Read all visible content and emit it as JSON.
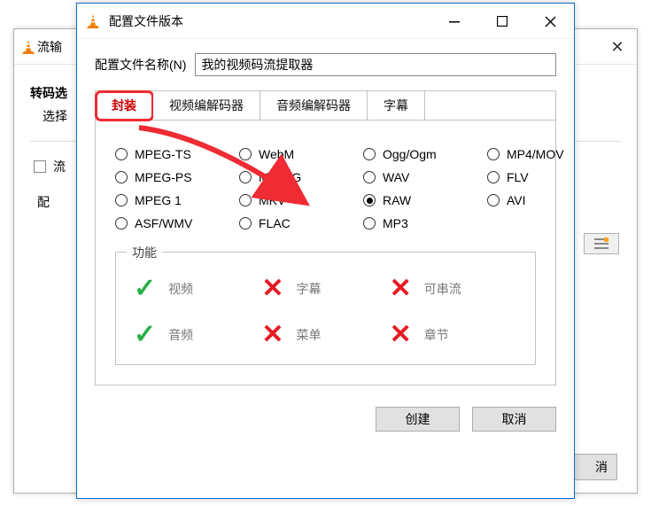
{
  "back": {
    "title": "流输",
    "section_heading": "转码选",
    "section_sub": "选择",
    "checkbox_label": "流",
    "config_label": "配",
    "cancel_partial": "消"
  },
  "front": {
    "title": "配置文件版本",
    "name_label": "配置文件名称(N)",
    "name_value": "我的视频码流提取器",
    "tabs": {
      "encap": "封装",
      "video": "视频编解码器",
      "audio": "音频编解码器",
      "subs": "字幕"
    },
    "radios": {
      "mpegts": "MPEG-TS",
      "webm": "WebM",
      "ogg": "Ogg/Ogm",
      "mp4": "MP4/MOV",
      "mpegps": "MPEG-PS",
      "mjpeg": "MJPEG",
      "wav": "WAV",
      "flv": "FLV",
      "mpeg1": "MPEG 1",
      "mkv": "MKV",
      "raw": "RAW",
      "avi": "AVI",
      "asf": "ASF/WMV",
      "flac": "FLAC",
      "mp3": "MP3"
    },
    "features_legend": "功能",
    "features": {
      "video": "视频",
      "subs": "字幕",
      "stream": "可串流",
      "audio": "音频",
      "menu": "菜单",
      "chapters": "章节"
    },
    "create": "创建",
    "cancel": "取消"
  }
}
